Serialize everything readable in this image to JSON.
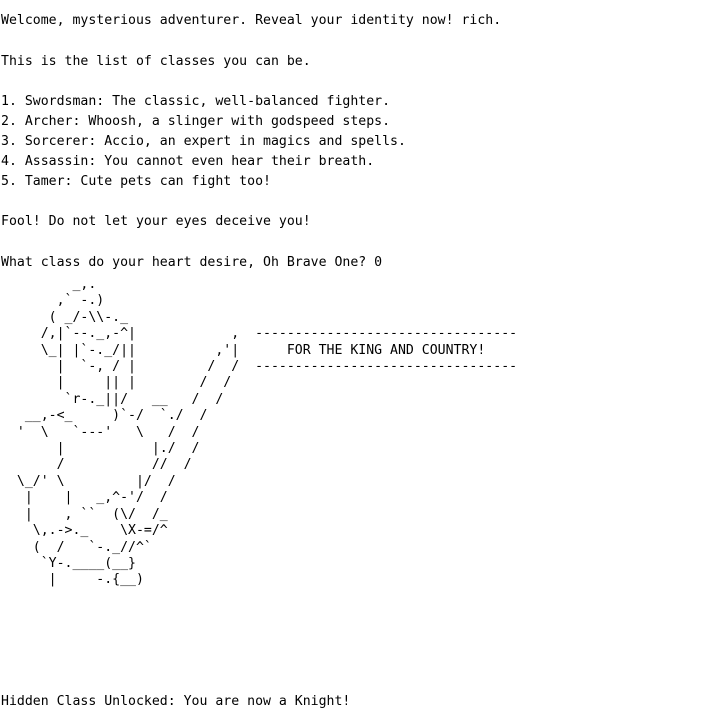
{
  "console": {
    "welcome": "Welcome, mysterious adventurer. Reveal your identity now! rich.",
    "list_intro": "This is the list of classes you can be.",
    "classes": [
      "1. Swordsman: The classic, well-balanced fighter.",
      "2. Archer: Whoosh, a slinger with godspeed steps.",
      "3. Sorcerer: Accio, an expert in magics and spells.",
      "4. Assassin: You cannot even hear their breath.",
      "5. Tamer: Cute pets can fight too!"
    ],
    "warning": "Fool! Do not let your eyes deceive you!",
    "prompt": "What class do your heart desire, Oh Brave One? 0",
    "ascii_art": "         _,.\n       ,` -.)\n      ( _/-\\\\-._\n     /,|`--._,-^|            ,  ---------------------------------\n     \\_| |`-._/||          ,'|      FOR THE KING AND COUNTRY!\n       |  `-, / |         /  /  ---------------------------------\n       |     || |        /  /\n        `r-._||/   __   /  /\n   __,-<_     )`-/  `./  /\n  '  \\   `---'   \\   /  /\n       |           |./  /\n       /           //  /\n  \\_/' \\         |/  /\n   |    |   _,^-'/  /\n   |    , ``  (\\/  /_\n    \\,.->._    \\X-=/^\n    (  /   `-._//^`\n     `Y-.____(__}\n      |     -.{__)",
    "result": "Hidden Class Unlocked: You are now a Knight!"
  }
}
